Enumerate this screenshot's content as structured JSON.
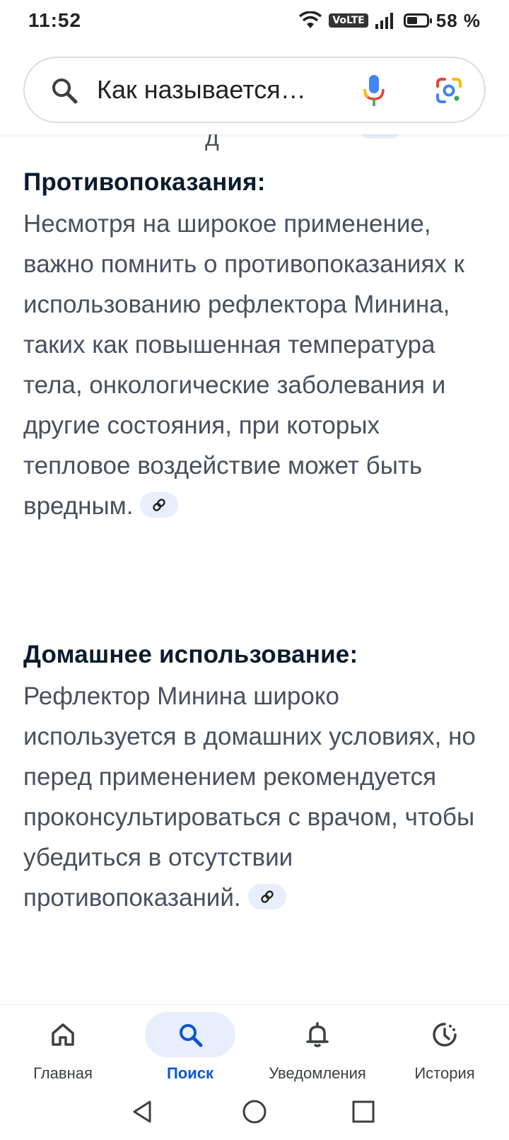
{
  "status_bar": {
    "time": "11:52",
    "network_badge": "VoLTE",
    "battery_percent": "58 %",
    "battery_level": 0.58
  },
  "search": {
    "query": "Как называется…"
  },
  "content": {
    "sections": [
      {
        "title": "Противопоказания:",
        "body": "Несмотря на широкое применение, важно помнить о противопоказаниях к использованию рефлектора Минина, таких как повышенная температура тела, онкологические заболевания и другие состояния, при которых тепловое воздействие может быть вредным."
      },
      {
        "title": "Домашнее использование:",
        "body": "Рефлектор Минина широко используется в домашних условиях, но перед применением рекомендуется проконсультироваться с врачом, чтобы убедиться в отсутствии противопоказаний."
      }
    ]
  },
  "bottom_nav": {
    "items": [
      {
        "label": "Главная",
        "icon": "home-icon",
        "active": false
      },
      {
        "label": "Поиск",
        "icon": "search-icon",
        "active": true
      },
      {
        "label": "Уведомления",
        "icon": "bell-icon",
        "active": false
      },
      {
        "label": "История",
        "icon": "history-icon",
        "active": false
      }
    ]
  },
  "colors": {
    "accent": "#0b57d0",
    "chip_bg": "#e8eefc",
    "body_text": "#4a4f5e",
    "title_text": "#0b1b2e"
  }
}
